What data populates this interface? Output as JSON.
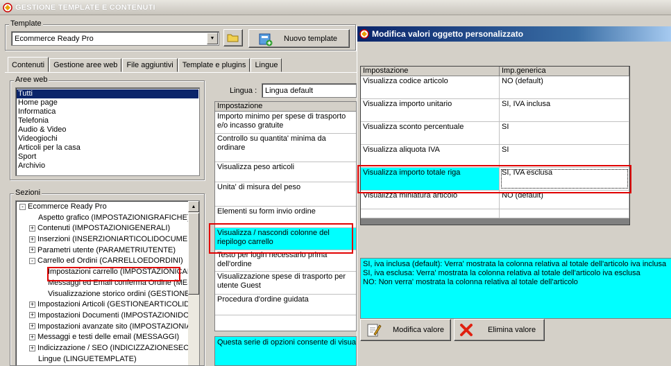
{
  "window": {
    "title": "GESTIONE TEMPLATE E CONTENUTI"
  },
  "template": {
    "group_label": "Template",
    "selected": "Ecommerce Ready Pro",
    "new_button": "Nuovo template"
  },
  "tabs": [
    "Contenuti",
    "Gestione aree web",
    "File aggiuntivi",
    "Template e plugins",
    "Lingue"
  ],
  "aree_web": {
    "label": "Aree web",
    "items": [
      "Tutti",
      "Home page",
      "Informatica",
      "Telefonia",
      "Audio & Video",
      "Videogiochi",
      "Articoli per la casa",
      "Sport",
      "Archivio"
    ]
  },
  "sezioni": {
    "label": "Sezioni",
    "items": [
      {
        "text": "Ecommerce Ready Pro",
        "expander": "-"
      },
      {
        "text": "Aspetto grafico (IMPOSTAZIONIGRAFICHE)",
        "expander": ""
      },
      {
        "text": "Contenuti (IMPOSTAZIONIGENERALI)",
        "expander": "+"
      },
      {
        "text": "Inserzioni (INSERZIONIARTICOLIDOCUMEN",
        "expander": "+"
      },
      {
        "text": "Parametri utente (PARAMETRIUTENTE)",
        "expander": "+"
      },
      {
        "text": "Carrello ed Ordini (CARRELLOEDORDINI)",
        "expander": "-"
      },
      {
        "text": "Impostazioni carrello (IMPOSTAZIONICAR",
        "expander": ""
      },
      {
        "text": "Messaggi ed Email conferma Ordine (MES",
        "expander": ""
      },
      {
        "text": "Visualizzazione storico ordini (GESTIONED",
        "expander": ""
      },
      {
        "text": "Impostazioni Articoli (GESTIONEARTICOLIDO",
        "expander": "+"
      },
      {
        "text": "Impostazioni Documenti (IMPOSTAZIONIDOC",
        "expander": "+"
      },
      {
        "text": "Impostazioni avanzate sito (IMPOSTAZIONIAT",
        "expander": "+"
      },
      {
        "text": "Messaggi e testi delle email (MESSAGGI)",
        "expander": "+"
      },
      {
        "text": "Indicizzazione / SEO (INDICIZZAZIONESEO)",
        "expander": "+"
      },
      {
        "text": "Lingue (LINGUETEMPLATE)",
        "expander": ""
      }
    ]
  },
  "lingua": {
    "label": "Lingua :",
    "value": "Lingua default"
  },
  "impostazioni_list": {
    "header": "Impostazione",
    "rows": [
      "Importo minimo per spese di trasporto e/o incasso gratuite",
      "Controllo su quantita' minima da ordinare",
      "Visualizza peso articoli",
      "Unita' di misura del peso",
      "Elementi su form invio ordine",
      "Visualizza / nascondi colonne del riepilogo carrello",
      "Testo per login necessario prima dell'ordine",
      "Visualizzazione spese di trasporto per utente Guest",
      "Procedura d'ordine guidata"
    ],
    "description": "Questa serie di opzioni consente di visua"
  },
  "dialog": {
    "title": "Modifica valori oggetto personalizzato",
    "columns": [
      "Impostazione",
      "Imp.generica"
    ],
    "rows": [
      {
        "setting": "Visualizza codice articolo",
        "value": "NO (default)"
      },
      {
        "setting": "Visualizza importo unitario",
        "value": "SI, IVA inclusa"
      },
      {
        "setting": "Visualizza sconto percentuale",
        "value": "SI"
      },
      {
        "setting": "Visualizza aliquota IVA",
        "value": "SI"
      },
      {
        "setting": "Visualizza importo totale riga",
        "value": "SI, IVA esclusa"
      },
      {
        "setting": "Visualizza miniatura articolo",
        "value": "NO (default)"
      }
    ],
    "description_lines": [
      "SI, iva inclusa (default): Verra' mostrata la colonna relativa al totale dell'articolo iva inclusa",
      "SI, iva esclusa: Verra' mostrata la colonna relativa al totale dell'articolo iva esclusa",
      "NO: Non verra' mostrata la colonna relativa al totale dell'articolo"
    ],
    "modify_button": "Modifica valore",
    "delete_button": "Elimina valore"
  },
  "colors": {
    "highlight": "#00ffff",
    "selection": "#0a246a",
    "annotation": "#e00000"
  }
}
